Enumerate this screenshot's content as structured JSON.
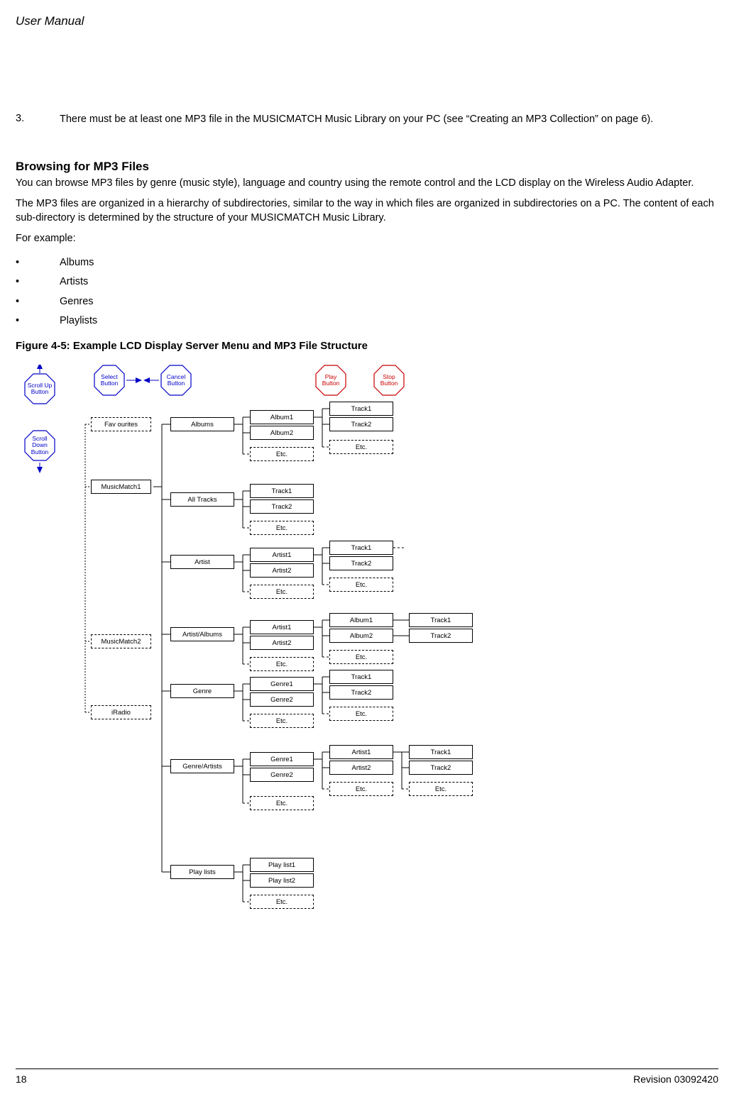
{
  "header": "User Manual",
  "step": {
    "num": "3.",
    "text": "There must be at least one MP3 file in the MUSICMATCH Music Library on your PC (see  “Creating an MP3 Collection” on page 6)."
  },
  "heading": "Browsing for MP3 Files",
  "p1": "You can browse MP3 files by genre (music style), language and country using the remote control and the LCD display on the Wireless Audio Adapter.",
  "p2": "The MP3 files are organized in a hierarchy of subdirectories, similar to the way in which files are organized in subdirectories on a PC. The content of each sub-directory is determined by the structure of your MUSICMATCH Music Library.",
  "p3": "For example:",
  "bullets": [
    "Albums",
    "Artists",
    "Genres",
    "Playlists"
  ],
  "figcaption": "Figure 4-5: Example LCD Display Server Menu and MP3 File Structure",
  "diagram": {
    "buttons": {
      "scroll_up": "Scroll Up\nButton",
      "scroll_down": "Scroll\nDown\nButton",
      "select": "Select\nButton",
      "cancel": "Cancel\nButton",
      "play": "Play\nButton",
      "stop": "Stop\nButton"
    },
    "col1": {
      "favourites": "Fav ourites",
      "mm1": "MusicMatch1",
      "mm2": "MusicMatch2",
      "iradio": "iRadio"
    },
    "col2": {
      "albums": "Albums",
      "all_tracks": "All Tracks",
      "artist": "Artist",
      "artist_albums": "Artist/Albums",
      "genre": "Genre",
      "genre_artists": "Genre/Artists",
      "playlists": "Play lists"
    },
    "gen": {
      "album1": "Album1",
      "album2": "Album2",
      "track1": "Track1",
      "track2": "Track2",
      "artist1": "Artist1",
      "artist2": "Artist2",
      "genre1": "Genre1",
      "genre2": "Genre2",
      "playlist1": "Play list1",
      "playlist2": "Play list2",
      "etc": "Etc."
    }
  },
  "footer": {
    "page": "18",
    "rev": "Revision 03092420"
  }
}
